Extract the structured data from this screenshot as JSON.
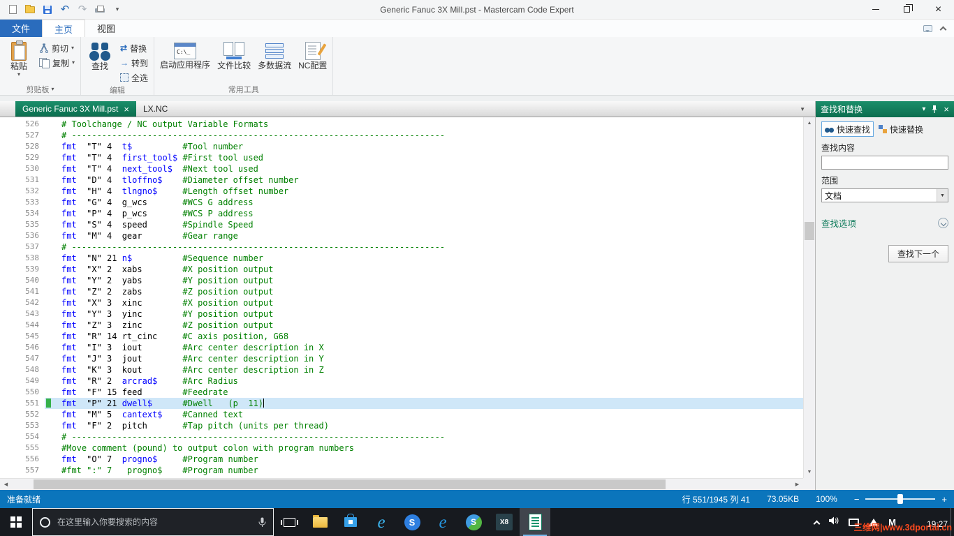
{
  "window": {
    "title": "Generic Fanuc 3X Mill.pst - Mastercam Code Expert"
  },
  "icons": {
    "dropdown": "▾",
    "undo": "↶",
    "redo": "↷",
    "close": "×",
    "tab_list": "▼",
    "select_arrow": "▼",
    "scroll_up": "▲",
    "scroll_down": "▼",
    "scroll_left": "◀",
    "scroll_right": "▶",
    "zoom_out": "−",
    "zoom_in": "+",
    "replace_arrows": "⇄",
    "goto_arrow": "→",
    "ie_letter": "e",
    "s_letter": "S",
    "x8_label": "X8",
    "tray_m": "M"
  },
  "ribbon": {
    "tabs": [
      {
        "label": "文件"
      },
      {
        "label": "主页"
      },
      {
        "label": "视图"
      }
    ],
    "clipboard": {
      "label": "剪贴板",
      "paste": "粘贴",
      "cut": "剪切",
      "copy": "复制"
    },
    "edit": {
      "label": "编辑",
      "find": "查找",
      "replace": "替换",
      "goto": "转到",
      "select_all": "全选"
    },
    "tools": {
      "label": "常用工具",
      "launch_app": "启动应用程序",
      "file_compare": "文件比较",
      "multi_stream": "多数据流",
      "nc_config": "NC配置"
    }
  },
  "doc_tabs": {
    "active": "Generic Fanuc 3X Mill.pst",
    "inactive": "LX.NC"
  },
  "editor": {
    "lines": [
      {
        "n": 526,
        "s": [
          [
            "c",
            "# Toolchange / NC output Variable Formats"
          ]
        ]
      },
      {
        "n": 527,
        "s": [
          [
            "c",
            "# --------------------------------------------------------------------------"
          ]
        ]
      },
      {
        "n": 528,
        "s": [
          [
            "k",
            "fmt"
          ],
          [
            "t",
            "  \"T\" 4  "
          ],
          [
            "k",
            "t$"
          ],
          [
            "t",
            "          "
          ],
          [
            "c",
            "#Tool number"
          ]
        ]
      },
      {
        "n": 529,
        "s": [
          [
            "k",
            "fmt"
          ],
          [
            "t",
            "  \"T\" 4  "
          ],
          [
            "k",
            "first_tool$"
          ],
          [
            "t",
            " "
          ],
          [
            "c",
            "#First tool used"
          ]
        ]
      },
      {
        "n": 530,
        "s": [
          [
            "k",
            "fmt"
          ],
          [
            "t",
            "  \"T\" 4  "
          ],
          [
            "k",
            "next_tool$"
          ],
          [
            "t",
            "  "
          ],
          [
            "c",
            "#Next tool used"
          ]
        ]
      },
      {
        "n": 531,
        "s": [
          [
            "k",
            "fmt"
          ],
          [
            "t",
            "  \"D\" 4  "
          ],
          [
            "k",
            "tloffno$"
          ],
          [
            "t",
            "    "
          ],
          [
            "c",
            "#Diameter offset number"
          ]
        ]
      },
      {
        "n": 532,
        "s": [
          [
            "k",
            "fmt"
          ],
          [
            "t",
            "  \"H\" 4  "
          ],
          [
            "k",
            "tlngno$"
          ],
          [
            "t",
            "     "
          ],
          [
            "c",
            "#Length offset number"
          ]
        ]
      },
      {
        "n": 533,
        "s": [
          [
            "k",
            "fmt"
          ],
          [
            "t",
            "  \"G\" 4  g_wcs       "
          ],
          [
            "c",
            "#WCS G address"
          ]
        ]
      },
      {
        "n": 534,
        "s": [
          [
            "k",
            "fmt"
          ],
          [
            "t",
            "  \"P\" 4  p_wcs       "
          ],
          [
            "c",
            "#WCS P address"
          ]
        ]
      },
      {
        "n": 535,
        "s": [
          [
            "k",
            "fmt"
          ],
          [
            "t",
            "  \"S\" 4  speed       "
          ],
          [
            "c",
            "#Spindle Speed"
          ]
        ]
      },
      {
        "n": 536,
        "s": [
          [
            "k",
            "fmt"
          ],
          [
            "t",
            "  \"M\" 4  gear        "
          ],
          [
            "c",
            "#Gear range"
          ]
        ]
      },
      {
        "n": 537,
        "s": [
          [
            "c",
            "# --------------------------------------------------------------------------"
          ]
        ]
      },
      {
        "n": 538,
        "s": [
          [
            "k",
            "fmt"
          ],
          [
            "t",
            "  \"N\" 21 "
          ],
          [
            "k",
            "n$"
          ],
          [
            "t",
            "          "
          ],
          [
            "c",
            "#Sequence number"
          ]
        ]
      },
      {
        "n": 539,
        "s": [
          [
            "k",
            "fmt"
          ],
          [
            "t",
            "  \"X\" 2  xabs        "
          ],
          [
            "c",
            "#X position output"
          ]
        ]
      },
      {
        "n": 540,
        "s": [
          [
            "k",
            "fmt"
          ],
          [
            "t",
            "  \"Y\" 2  yabs        "
          ],
          [
            "c",
            "#Y position output"
          ]
        ]
      },
      {
        "n": 541,
        "s": [
          [
            "k",
            "fmt"
          ],
          [
            "t",
            "  \"Z\" 2  zabs        "
          ],
          [
            "c",
            "#Z position output"
          ]
        ]
      },
      {
        "n": 542,
        "s": [
          [
            "k",
            "fmt"
          ],
          [
            "t",
            "  \"X\" 3  xinc        "
          ],
          [
            "c",
            "#X position output"
          ]
        ]
      },
      {
        "n": 543,
        "s": [
          [
            "k",
            "fmt"
          ],
          [
            "t",
            "  \"Y\" 3  yinc        "
          ],
          [
            "c",
            "#Y position output"
          ]
        ]
      },
      {
        "n": 544,
        "s": [
          [
            "k",
            "fmt"
          ],
          [
            "t",
            "  \"Z\" 3  zinc        "
          ],
          [
            "c",
            "#Z position output"
          ]
        ]
      },
      {
        "n": 545,
        "s": [
          [
            "k",
            "fmt"
          ],
          [
            "t",
            "  \"R\" 14 rt_cinc     "
          ],
          [
            "c",
            "#C axis position, G68"
          ]
        ]
      },
      {
        "n": 546,
        "s": [
          [
            "k",
            "fmt"
          ],
          [
            "t",
            "  \"I\" 3  iout        "
          ],
          [
            "c",
            "#Arc center description in X"
          ]
        ]
      },
      {
        "n": 547,
        "s": [
          [
            "k",
            "fmt"
          ],
          [
            "t",
            "  \"J\" 3  jout        "
          ],
          [
            "c",
            "#Arc center description in Y"
          ]
        ]
      },
      {
        "n": 548,
        "s": [
          [
            "k",
            "fmt"
          ],
          [
            "t",
            "  \"K\" 3  kout        "
          ],
          [
            "c",
            "#Arc center description in Z"
          ]
        ]
      },
      {
        "n": 549,
        "s": [
          [
            "k",
            "fmt"
          ],
          [
            "t",
            "  \"R\" 2  "
          ],
          [
            "k",
            "arcrad$"
          ],
          [
            "t",
            "     "
          ],
          [
            "c",
            "#Arc Radius"
          ]
        ]
      },
      {
        "n": 550,
        "s": [
          [
            "k",
            "fmt"
          ],
          [
            "t",
            "  \"F\" 15 feed        "
          ],
          [
            "c",
            "#Feedrate"
          ]
        ]
      },
      {
        "n": 551,
        "cur": true,
        "caret": true,
        "s": [
          [
            "k",
            "fmt"
          ],
          [
            "t",
            "  \"P\" 21 "
          ],
          [
            "k",
            "dwell$"
          ],
          [
            "t",
            "      "
          ],
          [
            "c",
            "#Dwell   (p  11)"
          ]
        ]
      },
      {
        "n": 552,
        "s": [
          [
            "k",
            "fmt"
          ],
          [
            "t",
            "  \"M\" 5  "
          ],
          [
            "k",
            "cantext$"
          ],
          [
            "t",
            "    "
          ],
          [
            "c",
            "#Canned text"
          ]
        ]
      },
      {
        "n": 553,
        "s": [
          [
            "k",
            "fmt"
          ],
          [
            "t",
            "  \"F\" 2  pitch       "
          ],
          [
            "c",
            "#Tap pitch (units per thread)"
          ]
        ]
      },
      {
        "n": 554,
        "s": [
          [
            "c",
            "# --------------------------------------------------------------------------"
          ]
        ]
      },
      {
        "n": 555,
        "s": [
          [
            "c",
            "#Move comment (pound) to output colon with program numbers"
          ]
        ]
      },
      {
        "n": 556,
        "s": [
          [
            "k",
            "fmt"
          ],
          [
            "t",
            "  \"O\" 7  "
          ],
          [
            "k",
            "progno$"
          ],
          [
            "t",
            "     "
          ],
          [
            "c",
            "#Program number"
          ]
        ]
      },
      {
        "n": 557,
        "s": [
          [
            "c",
            "#fmt \":\" 7   progno$    #Program number"
          ]
        ]
      }
    ]
  },
  "find_panel": {
    "title": "查找和替换",
    "quick_find": "快速查找",
    "quick_replace": "快速替换",
    "find_label": "查找内容",
    "find_value": "",
    "scope_label": "范围",
    "scope_value": "文档",
    "options_label": "查找选项",
    "find_next": "查找下一个"
  },
  "status_bar": {
    "ready": "准备就绪",
    "position": "行 551/1945 列 41",
    "file_size": "73.05KB",
    "zoom": "100%"
  },
  "taskbar": {
    "search_placeholder": "在这里输入你要搜索的内容",
    "time": "19:27",
    "watermark": "三维网|www.3dportal.cn"
  }
}
